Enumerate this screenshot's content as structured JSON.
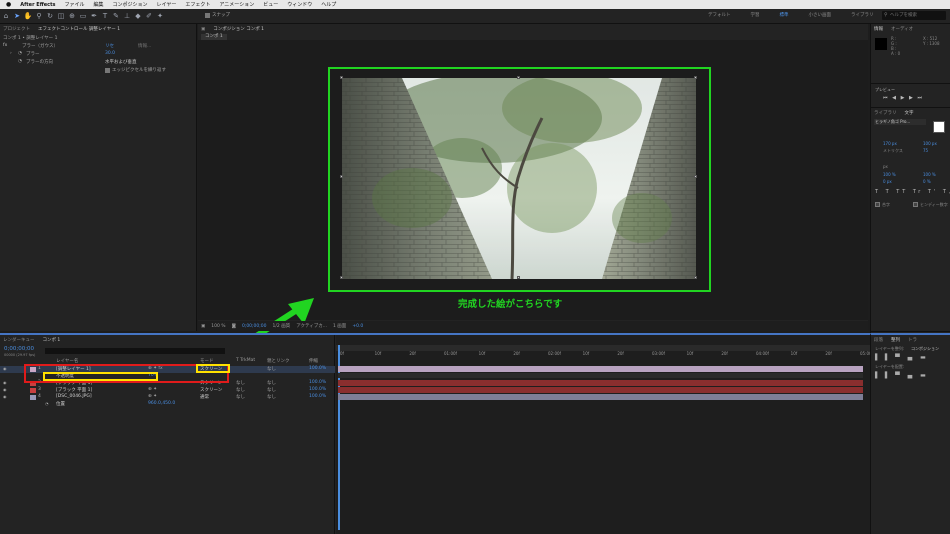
{
  "menubar": {
    "apple": "",
    "app": "After Effects",
    "items": [
      "ファイル",
      "編集",
      "コンポジション",
      "レイヤー",
      "エフェクト",
      "アニメーション",
      "ビュー",
      "ウィンドウ",
      "ヘルプ"
    ]
  },
  "toolbar": {
    "snap_label": "スナップ",
    "workspaces": [
      "デフォルト",
      "学習",
      "標準",
      "小さい画面",
      "ライブラリ"
    ],
    "selected_workspace": "標準",
    "help_placeholder": "ヘルプを検索"
  },
  "effect_controls": {
    "tabs": [
      "プロジェクト",
      "エフェクトコントロール 調整レイヤー 1"
    ],
    "breadcrumb": "コンポ 1 • 調整レイヤー 1",
    "effect_name": "ブラー（ガウス）",
    "reset": "リセ",
    "fx_label": "fx",
    "about": "情報...",
    "params": [
      {
        "name": "ブラー",
        "value": "30.0"
      },
      {
        "name": "ブラーの方向",
        "value": "水平および垂直"
      },
      {
        "name": "",
        "value": "エッジピクセルを繰り返す"
      }
    ]
  },
  "viewer": {
    "tab": "コンポジション コンポ 1",
    "subtab": "コンポ 1",
    "caption": "完成した絵がこちらです",
    "footer": [
      "100 %",
      "0;00;00;00",
      "1/2 画質",
      "アクティブカ...",
      "1 画面",
      "+0.0"
    ]
  },
  "right_panel": {
    "info_tabs": [
      "情報",
      "オーディオ"
    ],
    "info_values": [
      "R :",
      "G :",
      "B :",
      "A : 0",
      "X : 512",
      "Y : 1308"
    ],
    "preview_tab": "プレビュー",
    "char_tabs": [
      "ライブラリ",
      "文字"
    ],
    "font": "ヒラギノ角ゴ Pro...",
    "size": "170 px",
    "leading": "100 px",
    "metrics": "メトリクス",
    "tracking": "75",
    "scale_v": "100 %",
    "scale_h": "100 %",
    "baseline": "0 px",
    "tsume": "0 %",
    "ligature": "合字",
    "hindi": "ヒンディー数字",
    "px_unit": "px"
  },
  "timeline": {
    "tabs": [
      "レンダーキュー",
      "コンポ 1"
    ],
    "timecode": "0;00;00;00",
    "fps": "00000 (29.97 fps)",
    "search_placeholder": "",
    "headers": [
      "レイヤー名",
      "モード",
      "T TrkMat",
      "親とリンク",
      "伸縮"
    ],
    "ruler": [
      "0f",
      "10f",
      "20f",
      "01:00f",
      "10f",
      "20f",
      "02:00f",
      "10f",
      "20f",
      "03:00f",
      "10f",
      "20f",
      "04:00f",
      "10f",
      "20f",
      "05:00f"
    ],
    "layers": [
      {
        "num": "1",
        "name": "[調整レイヤー 1]",
        "mode": "スクリーン",
        "trkmat": "",
        "parent": "なし",
        "stretch": "100.0%",
        "label": "#c9a7c6"
      },
      {
        "num": "",
        "name": "不透明度",
        "mode": "",
        "trkmat": "",
        "parent": "",
        "stretch": "",
        "value": "70%"
      },
      {
        "num": "2",
        "name": "[ブラック 平面 1]",
        "mode": "スクリーン",
        "trkmat": "なし",
        "parent": "なし",
        "stretch": "100.0%",
        "label": "#c84040"
      },
      {
        "num": "3",
        "name": "[ブラック 平面 1]",
        "mode": "スクリーン",
        "trkmat": "なし",
        "parent": "なし",
        "stretch": "100.0%",
        "label": "#c84040"
      },
      {
        "num": "4",
        "name": "[DSC_0046.JPG]",
        "mode": "通常",
        "trkmat": "なし",
        "parent": "なし",
        "stretch": "100.0%",
        "label": "#9a9ab8"
      },
      {
        "num": "",
        "name": "位置",
        "mode": "",
        "trkmat": "",
        "parent": "",
        "stretch": "",
        "value": "960.0,450.0"
      }
    ]
  },
  "bottom_right": {
    "tabs": [
      "段落",
      "整列",
      "トラ"
    ],
    "align_to_label": "レイヤーを整列:",
    "align_to_value": "コンポジション",
    "distribute": "レイヤーを配置:"
  },
  "colors": {
    "accent": "#4a8ee0",
    "highlight_green": "#21d421",
    "highlight_red": "#e01b1b",
    "highlight_yellow": "#ffe100"
  }
}
